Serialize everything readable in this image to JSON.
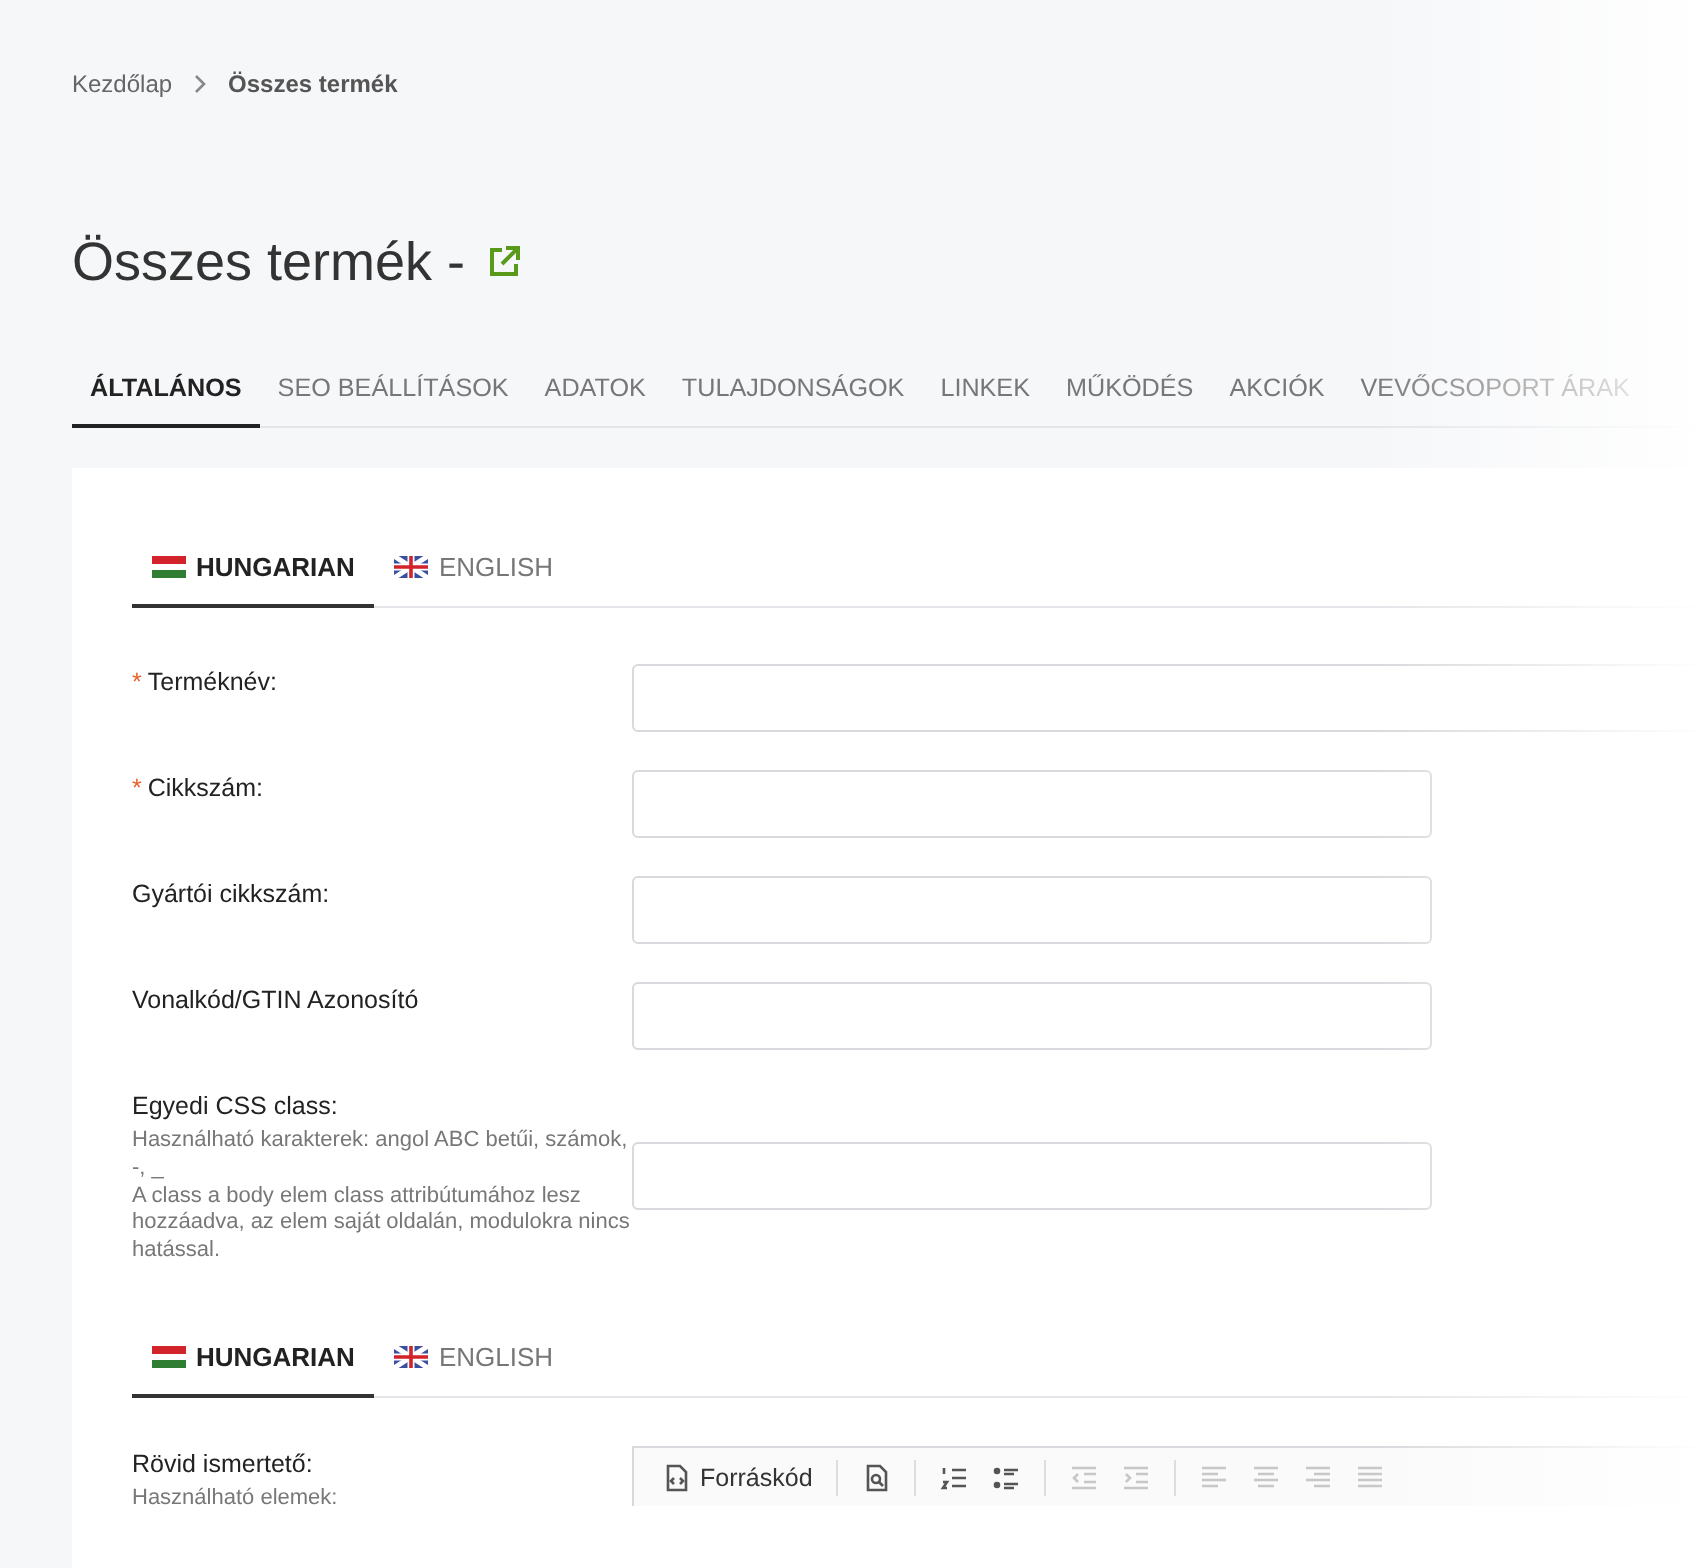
{
  "breadcrumb": [
    {
      "label": "Kezdőlap"
    },
    {
      "label": "Összes termék"
    }
  ],
  "page_title": "Összes termék -",
  "tabs": [
    {
      "label": "ÁLTALÁNOS",
      "selected": true
    },
    {
      "label": "SEO BEÁLLÍTÁSOK",
      "selected": false
    },
    {
      "label": "ADATOK",
      "selected": false
    },
    {
      "label": "TULAJDONSÁGOK",
      "selected": false
    },
    {
      "label": "LINKEK",
      "selected": false
    },
    {
      "label": "MŰKÖDÉS",
      "selected": false
    },
    {
      "label": "AKCIÓK",
      "selected": false
    },
    {
      "label": "VEVŐCSOPORT ÁRAK",
      "selected": false
    }
  ],
  "language_tabs": [
    {
      "label": "HUNGARIAN",
      "selected": true
    },
    {
      "label": "ENGLISH",
      "selected": false
    }
  ],
  "fields": [
    {
      "label": "Terméknév:",
      "required_mark": "*",
      "wide": true
    },
    {
      "label": "Cikkszám:",
      "required_mark": "*",
      "wide": false
    },
    {
      "label": "Gyártói cikkszám:",
      "wide": false
    },
    {
      "label": "Vonalkód/GTIN Azonosító",
      "wide": false
    },
    {
      "label": "Egyedi CSS class:",
      "wide": false,
      "hint": "Használható karakterek: angol ABC betűi, számok, -, _\nA class a body elem class attribútumához lesz hozzáadva, az elem saját oldalán, modulokra nincs hatással."
    }
  ],
  "language_tabs_2": [
    {
      "label": "HUNGARIAN",
      "selected": true
    },
    {
      "label": "ENGLISH",
      "selected": false
    }
  ],
  "short_description": {
    "label": "Rövid ismertető:",
    "hint": "Használható elemek:",
    "toolbar": [
      {
        "kind": "source",
        "label": "Forráskód",
        "disabled": false
      },
      {
        "kind": "preview",
        "disabled": false
      },
      {
        "kind": "numbered-list",
        "disabled": false
      },
      {
        "kind": "bulleted-list",
        "disabled": false
      },
      {
        "kind": "outdent",
        "disabled": true
      },
      {
        "kind": "indent",
        "disabled": true
      },
      {
        "kind": "align-left",
        "disabled": true
      },
      {
        "kind": "align-center",
        "disabled": true
      },
      {
        "kind": "align-right",
        "disabled": true
      },
      {
        "kind": "justify",
        "disabled": true
      }
    ]
  }
}
